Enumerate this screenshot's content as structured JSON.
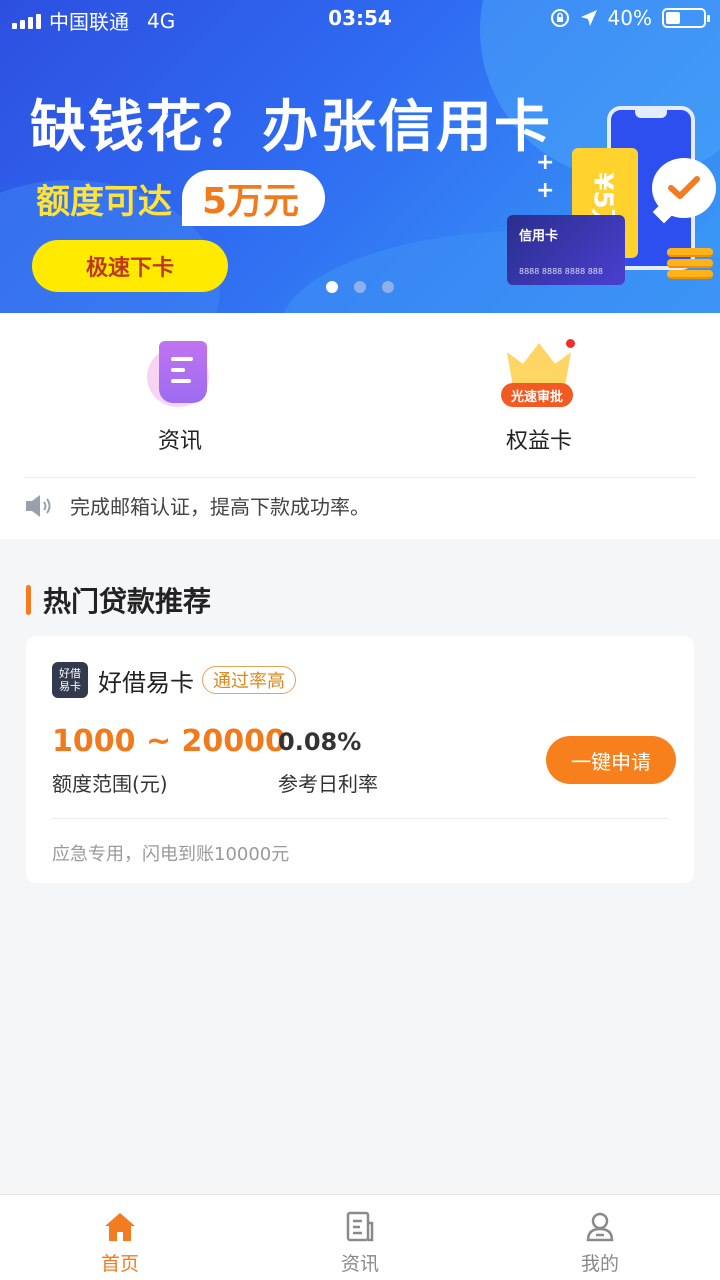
{
  "status_bar": {
    "carrier": "中国联通",
    "network": "4G",
    "time": "03:54",
    "battery": "40%",
    "battery_level": 0.4
  },
  "banner": {
    "headline": "缺钱花？办张信用卡",
    "limit_text": "额度可达",
    "limit_value": "5万元",
    "cta": "极速下卡",
    "ticket_text": "¥5万",
    "card_title": "信用卡",
    "card_number": "8888 8888 8888 888",
    "page_count": 3,
    "active_page": 0
  },
  "quick_entries": [
    {
      "label": "资讯",
      "icon": "document-icon"
    },
    {
      "label": "权益卡",
      "icon": "crown-icon",
      "tag": "光速审批"
    }
  ],
  "notice": {
    "text": "完成邮箱认证，提高下款成功率。",
    "icon": "speaker-icon"
  },
  "section": {
    "title": "热门贷款推荐"
  },
  "loan": {
    "logo_text": "好借易卡",
    "name": "好借易卡",
    "badge": "通过率高",
    "amount": "1000 ~ 20000",
    "amount_label": "额度范围(元)",
    "rate": "0.08%",
    "rate_label": "参考日利率",
    "apply": "一键申请",
    "note": "应急专用，闪电到账10000元"
  },
  "tabbar": [
    {
      "label": "首页",
      "icon": "home-icon",
      "active": true
    },
    {
      "label": "资讯",
      "icon": "news-icon",
      "active": false
    },
    {
      "label": "我的",
      "icon": "user-icon",
      "active": false
    }
  ],
  "colors": {
    "accent": "#f37b21",
    "banner_blue": "#2f6cf2",
    "cta_yellow": "#ffea00"
  }
}
